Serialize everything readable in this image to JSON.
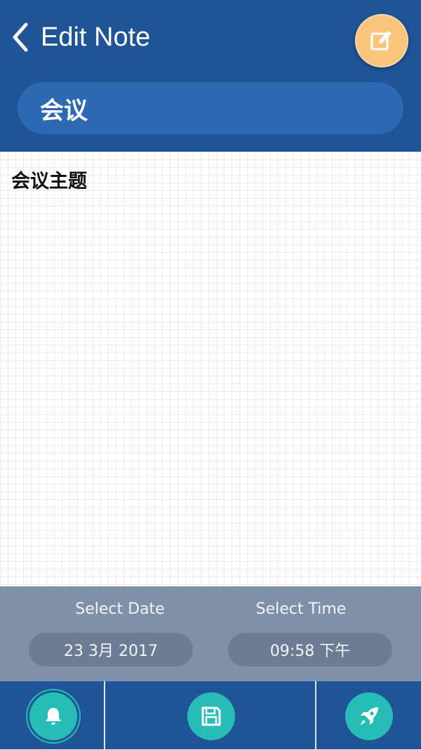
{
  "header": {
    "title": "Edit Note",
    "back_icon": "chevron-left-icon",
    "edit_icon": "edit-square-icon"
  },
  "note": {
    "title": "会议",
    "body": "会议主题"
  },
  "datetime": {
    "date_label": "Select Date",
    "date_value": "23 3月 2017",
    "time_label": "Select Time",
    "time_value": "09:58 下午"
  },
  "footer": {
    "reminder_icon": "bell-icon",
    "save_icon": "floppy-disk-icon",
    "launch_icon": "rocket-icon"
  },
  "colors": {
    "primary": "#1f5496",
    "title_field": "#2d69b2",
    "accent_orange": "#fbc47c",
    "accent_teal": "#27bdb6",
    "panel_gray": "#8090a9"
  }
}
